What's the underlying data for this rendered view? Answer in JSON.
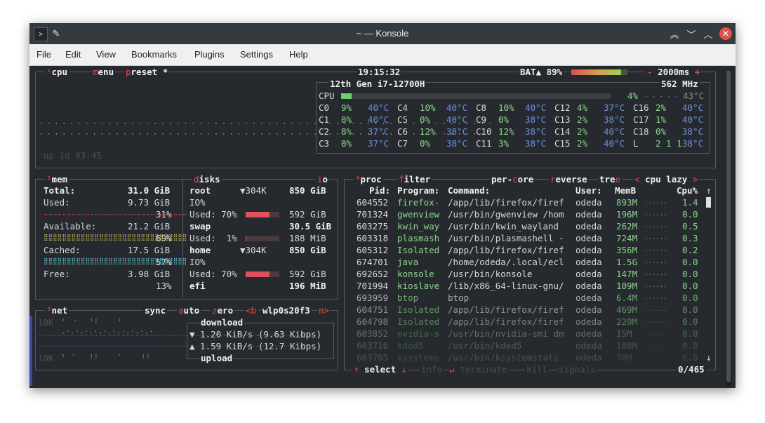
{
  "window": {
    "title": "~ — Konsole"
  },
  "menubar": [
    "File",
    "Edit",
    "View",
    "Bookmarks",
    "Plugins",
    "Settings",
    "Help"
  ],
  "cpu_box": {
    "label_cpu": "cpu",
    "label_menu": "menu",
    "label_preset": "preset",
    "preset_value": "*",
    "clock": "19:15:32",
    "battery": "BAT▲ 89%",
    "refresh": "2000ms",
    "uptime": "up 1d 03:45",
    "cpu_name": "12th Gen i7-12700H",
    "cpu_freq": "562 MHz",
    "total_label": "CPU",
    "total_pct": "4%",
    "total_temp": "43°C",
    "total_fill": 0.04,
    "battery_level": 0.89,
    "cores": [
      {
        "name": "C0",
        "pct": "9%",
        "temp": "40°C"
      },
      {
        "name": "C4",
        "pct": "10%",
        "temp": "40°C"
      },
      {
        "name": "C8",
        "pct": "10%",
        "temp": "40°C"
      },
      {
        "name": "C12",
        "pct": "4%",
        "temp": "37°C"
      },
      {
        "name": "C16",
        "pct": "2%",
        "temp": "40°C"
      },
      {
        "name": "C1",
        "pct": "0%",
        "temp": "40°C"
      },
      {
        "name": "C5",
        "pct": "0%",
        "temp": "40°C"
      },
      {
        "name": "C9",
        "pct": "0%",
        "temp": "38°C"
      },
      {
        "name": "C13",
        "pct": "2%",
        "temp": "38°C"
      },
      {
        "name": "C17",
        "pct": "1%",
        "temp": "40°C"
      },
      {
        "name": "C2",
        "pct": "8%",
        "temp": "37°C"
      },
      {
        "name": "C6",
        "pct": "12%",
        "temp": "38°C"
      },
      {
        "name": "C10",
        "pct": "12%",
        "temp": "38°C"
      },
      {
        "name": "C14",
        "pct": "2%",
        "temp": "40°C"
      },
      {
        "name": "C18",
        "pct": "0%",
        "temp": "38°C"
      },
      {
        "name": "C3",
        "pct": "0%",
        "temp": "37°C"
      },
      {
        "name": "C7",
        "pct": "0%",
        "temp": "38°C"
      },
      {
        "name": "C11",
        "pct": "3%",
        "temp": "38°C"
      },
      {
        "name": "C15",
        "pct": "2%",
        "temp": "40°C"
      },
      {
        "name": "L",
        "pct": "2 1 1",
        "temp": "38°C"
      }
    ]
  },
  "mem_box": {
    "label": "mem",
    "total_label": "Total:",
    "total_value": "31.0 GiB",
    "used_label": "Used:",
    "used_value": "9.73 GiB",
    "used_pct": "31%",
    "available_label": "Available:",
    "available_value": "21.2 GiB",
    "available_pct": "69%",
    "cached_label": "Cached:",
    "cached_value": "17.5 GiB",
    "cached_pct": "57%",
    "free_label": "Free:",
    "free_value": "3.98 GiB",
    "free_pct": "13%"
  },
  "disks_box": {
    "label": "disks",
    "label_io": "io",
    "entries": [
      {
        "name": "root",
        "io_rate": "▼304K",
        "size": "850 GiB",
        "io": "IO%",
        "used": "Used: 70%",
        "used_value": "592 GiB",
        "fill": 0.7
      },
      {
        "name": "swap",
        "io_rate": "",
        "size": "30.5 GiB",
        "io": "",
        "used": "Used:  1%",
        "used_value": "188 MiB",
        "fill": 0.01
      },
      {
        "name": "home",
        "io_rate": "▼304K",
        "size": "850 GiB",
        "io": "IO%",
        "used": "Used: 70%",
        "used_value": "592 GiB",
        "fill": 0.7
      },
      {
        "name": "efi",
        "io_rate": "",
        "size": "196 MiB",
        "io": "",
        "used": "",
        "used_value": "",
        "fill": 0
      }
    ]
  },
  "net_box": {
    "label": "net",
    "sync": "sync",
    "auto": "auto",
    "zero": "zero",
    "b_key": "<b",
    "interface": "wlp0s20f3",
    "n_key": "n>",
    "scale_top": "10K",
    "scale_bottom": "10K",
    "download_label": "download",
    "download_value": "▼ 1.20 KiB/s (9.63 Kibps)",
    "upload_value": "▲ 1.59 KiB/s (12.7 Kibps)",
    "upload_label": "upload"
  },
  "proc_box": {
    "label": "proc",
    "filter": "filter",
    "per_core": "per-core",
    "reverse": "reverse",
    "tree": "tree",
    "sort_left": "<",
    "sort_field": "cpu lazy",
    "sort_right": ">",
    "headers": {
      "pid": "Pid:",
      "program": "Program:",
      "command": "Command:",
      "user": "User:",
      "mem": "MemB",
      "cpu": "Cpu%"
    },
    "rows": [
      {
        "pid": "604552",
        "program": "firefox-",
        "command": "/app/lib/firefox/firef",
        "user": "odeda",
        "mem": "893M",
        "cpu": "1.4"
      },
      {
        "pid": "701324",
        "program": "gwenview",
        "command": "/usr/bin/gwenview /hom",
        "user": "odeda",
        "mem": "196M",
        "cpu": "0.0"
      },
      {
        "pid": "603275",
        "program": "kwin_way",
        "command": "/usr/bin/kwin_wayland",
        "user": "odeda",
        "mem": "262M",
        "cpu": "0.5"
      },
      {
        "pid": "603318",
        "program": "plasmash",
        "command": "/usr/bin/plasmashell -",
        "user": "odeda",
        "mem": "724M",
        "cpu": "0.3"
      },
      {
        "pid": "605312",
        "program": "Isolated",
        "command": "/app/lib/firefox/firef",
        "user": "odeda",
        "mem": "356M",
        "cpu": "0.2"
      },
      {
        "pid": "674701",
        "program": "java",
        "command": "/home/odeda/.local/ecl",
        "user": "odeda",
        "mem": "1.5G",
        "cpu": "0.0"
      },
      {
        "pid": "692652",
        "program": "konsole",
        "command": "/usr/bin/konsole",
        "user": "odeda",
        "mem": "147M",
        "cpu": "0.0"
      },
      {
        "pid": "701994",
        "program": "kioslave",
        "command": "/lib/x86_64-linux-gnu/",
        "user": "odeda",
        "mem": "109M",
        "cpu": "0.0"
      },
      {
        "pid": "693959",
        "program": "btop",
        "command": "btop",
        "user": "odeda",
        "mem": "6.4M",
        "cpu": "0.0"
      },
      {
        "pid": "604751",
        "program": "Isolated",
        "command": "/app/lib/firefox/firef",
        "user": "odeda",
        "mem": "469M",
        "cpu": "0.0"
      },
      {
        "pid": "604798",
        "program": "Isolated",
        "command": "/app/lib/firefox/firef",
        "user": "odeda",
        "mem": "220M",
        "cpu": "0.0"
      },
      {
        "pid": "603852",
        "program": "nvidia-s",
        "command": "/usr/bin/nvidia-smi dm",
        "user": "odeda",
        "mem": "15M",
        "cpu": "0.0"
      },
      {
        "pid": "603716",
        "program": "kded5",
        "command": "/usr/bin/kded5",
        "user": "odeda",
        "mem": "108M",
        "cpu": "0.0"
      },
      {
        "pid": "603705",
        "program": "ksystems",
        "command": "/usr/bin/ksystemstats",
        "user": "odeda",
        "mem": "70M",
        "cpu": "0.0"
      }
    ],
    "footer_select": "select",
    "footer_info": "info",
    "footer_terminate": "terminate",
    "footer_kill": "kill",
    "footer_signals": "signals",
    "count": "0/465"
  }
}
